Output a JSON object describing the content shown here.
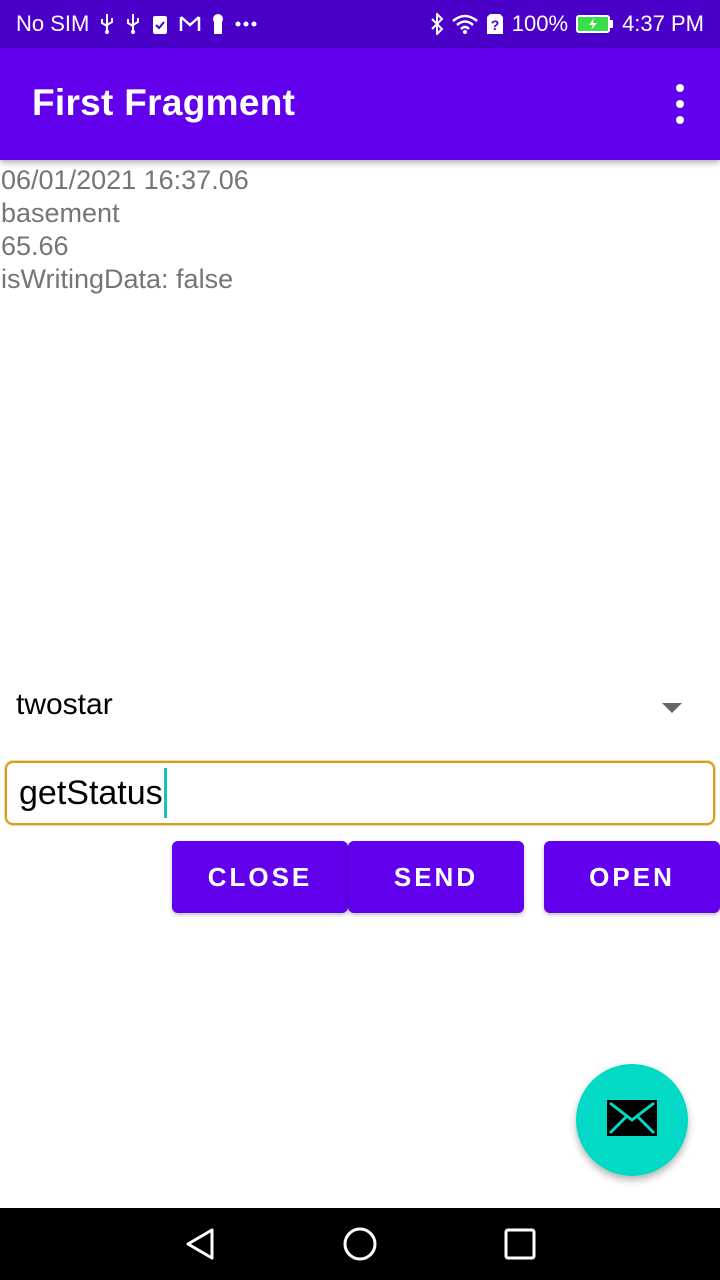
{
  "status_bar": {
    "carrier": "No SIM",
    "battery": "100%",
    "time": "4:37 PM",
    "left_icons": [
      "usb-icon",
      "usb-icon",
      "clipboard-check-icon",
      "gmail-icon",
      "keyhole-icon",
      "more-horizontal-icon"
    ],
    "right_icons": [
      "bluetooth-icon",
      "wifi-icon",
      "sim-unknown-icon",
      "battery-charging-icon"
    ]
  },
  "app_bar": {
    "title": "First Fragment",
    "menu_icon": "overflow-vertical-icon"
  },
  "info": {
    "timestamp": "06/01/2021 16:37.06",
    "location": "basement",
    "value": "65.66",
    "writing_status": "isWritingData: false"
  },
  "spinner": {
    "selected": "twostar"
  },
  "command": {
    "value": "getStatus"
  },
  "buttons": {
    "close": "CLOSE",
    "send": "SEND",
    "open": "OPEN"
  },
  "fab": {
    "icon": "email-icon"
  },
  "nav": {
    "back_icon": "back-icon",
    "home_icon": "home-icon",
    "recents_icon": "recents-icon"
  },
  "colors": {
    "status_bar": "#4a00c8",
    "primary": "#6200ee",
    "accent": "#03dac5",
    "input_border": "#d4a017"
  }
}
